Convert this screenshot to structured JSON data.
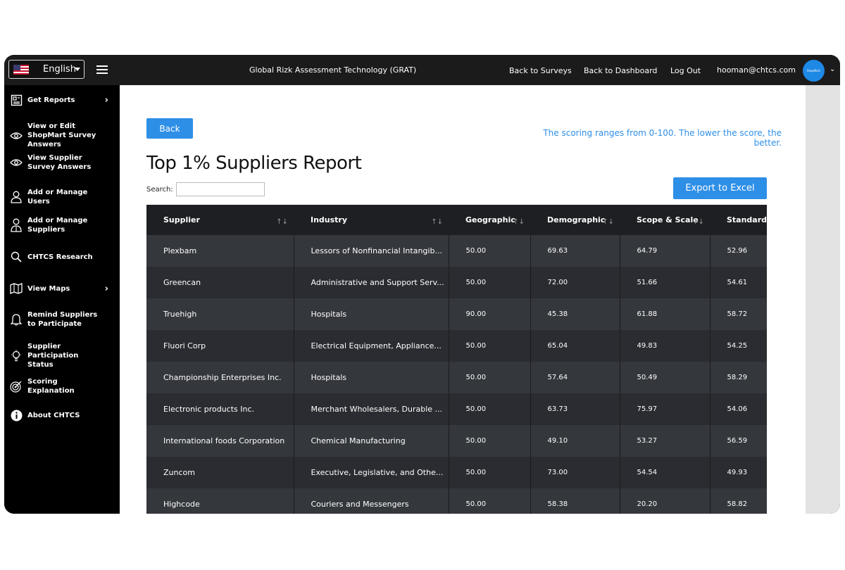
{
  "header": {
    "language": "English",
    "app_title": "Global Rizk Assessment Technology (GRAT)",
    "nav": [
      "Back to Surveys",
      "Back to Dashboard",
      "Log Out"
    ],
    "user_email": "hooman@chtcs.com",
    "avatar_text": "ShopMart"
  },
  "sidebar": {
    "items": [
      {
        "label": "Get Reports",
        "icon": "report-icon",
        "has_chevron": true
      },
      {
        "label": "View or Edit ShopMart Survey Answers",
        "icon": "eye-icon",
        "has_chevron": false
      },
      {
        "label": "View Supplier Survey Answers",
        "icon": "eye-icon",
        "has_chevron": false
      },
      {
        "label": "Add or Manage Users",
        "icon": "user-icon",
        "has_chevron": false
      },
      {
        "label": "Add or Manage Suppliers",
        "icon": "supplier-icon",
        "has_chevron": false
      },
      {
        "label": "CHTCS Research",
        "icon": "search-icon",
        "has_chevron": false
      },
      {
        "label": "View Maps",
        "icon": "map-icon",
        "has_chevron": true
      },
      {
        "label": "Remind Suppliers to Participate",
        "icon": "bell-icon",
        "has_chevron": false
      },
      {
        "label": "Supplier Participation Status",
        "icon": "lightbulb-icon",
        "has_chevron": false
      },
      {
        "label": "Scoring Explanation",
        "icon": "target-icon",
        "has_chevron": false
      },
      {
        "label": "About CHTCS",
        "icon": "info-icon",
        "has_chevron": false
      }
    ]
  },
  "main": {
    "back_label": "Back",
    "scoring_note": "The scoring ranges from 0-100. The lower the score, the better.",
    "title": "Top 1% Suppliers Report",
    "search_label": "Search:",
    "search_value": "",
    "export_label": "Export to Excel",
    "table": {
      "columns": [
        "Supplier",
        "Industry",
        "Geographic",
        "Demographic",
        "Scope & Scale",
        "Standards"
      ],
      "rows": [
        [
          "Plexbam",
          "Lessors of Nonfinancial Intangib...",
          "50.00",
          "69.63",
          "64.79",
          "52.96"
        ],
        [
          "Greencan",
          "Administrative and Support Serv...",
          "50.00",
          "72.00",
          "51.66",
          "54.61"
        ],
        [
          "Truehigh",
          "Hospitals",
          "90.00",
          "45.38",
          "61.88",
          "58.72"
        ],
        [
          "Fluori Corp",
          "Electrical Equipment, Appliance...",
          "50.00",
          "65.04",
          "49.83",
          "54.25"
        ],
        [
          "Championship Enterprises Inc.",
          "Hospitals",
          "50.00",
          "57.64",
          "50.49",
          "58.29"
        ],
        [
          "Electronic products Inc.",
          "Merchant Wholesalers, Durable ...",
          "50.00",
          "63.73",
          "75.97",
          "54.06"
        ],
        [
          "International foods Corporation",
          "Chemical Manufacturing",
          "50.00",
          "49.10",
          "53.27",
          "56.59"
        ],
        [
          "Zuncom",
          "Executive, Legislative, and Othe...",
          "50.00",
          "73.00",
          "54.54",
          "49.93"
        ],
        [
          "Highcode",
          "Couriers and Messengers",
          "50.00",
          "58.38",
          "20.20",
          "58.82"
        ]
      ]
    }
  },
  "colors": {
    "accent": "#2e8fe6",
    "topbar": "#1b1b1b",
    "sidebar": "#000000",
    "table_header": "#1e1f22",
    "table_row_odd": "#34373c",
    "table_row_even": "#2a2c31"
  }
}
